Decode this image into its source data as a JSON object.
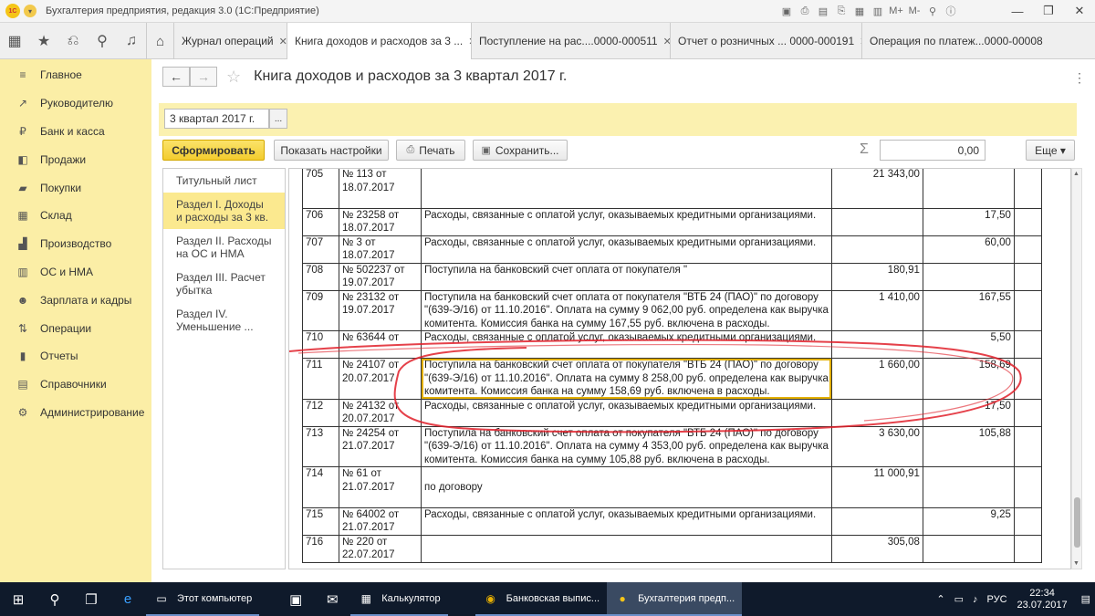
{
  "titlebar": {
    "title": "Бухгалтерия предприятия, редакция 3.0 (1С:Предприятие)",
    "logo": "1С"
  },
  "tabs": [
    {
      "label": "Журнал операций"
    },
    {
      "label": "Книга доходов и расходов за 3 ..."
    },
    {
      "label": "Поступление на рас....0000-000511"
    },
    {
      "label": "Отчет о розничных ... 0000-000191"
    },
    {
      "label": "Операция по платеж...0000-00008"
    }
  ],
  "sidebar": {
    "items": [
      {
        "label": "Главное",
        "icon": "list-icon"
      },
      {
        "label": "Руководителю",
        "icon": "chart-icon"
      },
      {
        "label": "Банк и касса",
        "icon": "ruble-icon"
      },
      {
        "label": "Продажи",
        "icon": "cart-icon"
      },
      {
        "label": "Покупки",
        "icon": "truck-icon"
      },
      {
        "label": "Склад",
        "icon": "warehouse-icon"
      },
      {
        "label": "Производство",
        "icon": "factory-icon"
      },
      {
        "label": "ОС и НМА",
        "icon": "building-icon"
      },
      {
        "label": "Зарплата и кадры",
        "icon": "people-icon"
      },
      {
        "label": "Операции",
        "icon": "dt-kt-icon"
      },
      {
        "label": "Отчеты",
        "icon": "report-icon"
      },
      {
        "label": "Справочники",
        "icon": "book-icon"
      },
      {
        "label": "Администрирование",
        "icon": "gear-icon"
      }
    ]
  },
  "header": {
    "title": "Книга доходов и расходов за 3 квартал 2017 г.",
    "back": "←",
    "forward": "→"
  },
  "params": {
    "period": "3 квартал 2017 г.",
    "period_btn": "..."
  },
  "toolbar": {
    "generate": "Сформировать",
    "show_settings": "Показать настройки",
    "print": "Печать",
    "save": "Сохранить...",
    "sigma": "Σ",
    "sum": "0,00",
    "more": "Еще ▾"
  },
  "toc": [
    {
      "label": "Титульный лист"
    },
    {
      "label": "Раздел I. Доходы и расходы за 3 кв."
    },
    {
      "label": "Раздел II. Расходы на ОС и НМА"
    },
    {
      "label": "Раздел III. Расчет убытка"
    },
    {
      "label": "Раздел IV. Уменьшение ..."
    }
  ],
  "rows": [
    {
      "n": "705",
      "doc": [
        "№ 113 от",
        "18.07.2017"
      ],
      "text": [
        "",
        "",
        ""
      ],
      "income": "21 343,00",
      "expense": ""
    },
    {
      "n": "706",
      "doc": [
        "№ 23258 от",
        "18.07.2017"
      ],
      "text": [
        "Расходы, связанные с оплатой услуг, оказываемых кредитными организациями."
      ],
      "income": "",
      "expense": "17,50"
    },
    {
      "n": "707",
      "doc": [
        "№ 3 от",
        "18.07.2017"
      ],
      "text": [
        "Расходы, связанные с оплатой услуг, оказываемых кредитными организациями."
      ],
      "income": "",
      "expense": "60,00"
    },
    {
      "n": "708",
      "doc": [
        "№ 502237 от",
        "19.07.2017"
      ],
      "text": [
        "Поступила на банковский счет оплата от покупателя \"",
        ""
      ],
      "income": "180,91",
      "expense": ""
    },
    {
      "n": "709",
      "doc": [
        "№ 23132 от",
        "19.07.2017"
      ],
      "text": [
        "Поступила на банковский счет оплата от покупателя \"ВТБ 24 (ПАО)\" по договору",
        "\"(639-Э/16) от 11.10.2016\". Оплата на сумму 9 062,00 руб. определена как выручка",
        "комитента. Комиссия банка на сумму 167,55 руб. включена в расходы."
      ],
      "income": "1 410,00",
      "expense": "167,55"
    },
    {
      "n": "710",
      "doc": [
        "№ 63644 от",
        ""
      ],
      "text": [
        "Расходы, связанные с оплатой услуг, оказываемых кредитными организациями."
      ],
      "income": "",
      "expense": "5,50"
    },
    {
      "n": "711",
      "doc": [
        "№ 24107 от",
        "20.07.2017"
      ],
      "text": [
        "Поступила на банковский счет оплата от покупателя \"ВТБ 24 (ПАО)\" по договору",
        "\"(639-Э/16) от 11.10.2016\". Оплата на сумму 8 258,00 руб. определена как выручка",
        "комитента. Комиссия банка на сумму 158,69 руб. включена в расходы."
      ],
      "income": "1 660,00",
      "expense": "158,69",
      "selected": true
    },
    {
      "n": "712",
      "doc": [
        "№ 24132 от",
        "20.07.2017"
      ],
      "text": [
        "Расходы, связанные с оплатой услуг, оказываемых кредитными организациями."
      ],
      "income": "",
      "expense": "17,50"
    },
    {
      "n": "713",
      "doc": [
        "№ 24254 от",
        "21.07.2017"
      ],
      "text": [
        "Поступила на банковский счет оплата от покупателя \"ВТБ 24 (ПАО)\" по договору",
        "\"(639-Э/16) от 11.10.2016\". Оплата на сумму 4 353,00 руб. определена как выручка",
        "комитента. Комиссия банка на сумму 105,88 руб. включена в расходы."
      ],
      "income": "3 630,00",
      "expense": "105,88"
    },
    {
      "n": "714",
      "doc": [
        "№ 61 от",
        "21.07.2017"
      ],
      "text": [
        "",
        "по договору",
        ""
      ],
      "income": "11 000,91",
      "expense": ""
    },
    {
      "n": "715",
      "doc": [
        "№ 64002 от",
        "21.07.2017"
      ],
      "text": [
        "Расходы, связанные с оплатой услуг, оказываемых кредитными организациями."
      ],
      "income": "",
      "expense": "9,25"
    },
    {
      "n": "716",
      "doc": [
        "№ 220 от",
        "22.07.2017"
      ],
      "text": [
        "",
        ""
      ],
      "income": "305,08",
      "expense": ""
    }
  ],
  "taskbar": {
    "apps": [
      {
        "label": "Этот компьютер",
        "icon": "computer-icon"
      },
      {
        "label": "Калькулятор",
        "icon": "calculator-icon"
      },
      {
        "label": "Банковская выпис...",
        "icon": "chrome-icon"
      },
      {
        "label": "Бухгалтерия предп...",
        "icon": "1c-icon"
      }
    ],
    "lang": "РУС",
    "time": "22:34",
    "date": "23.07.2017"
  },
  "colors": {
    "sidebar": "#fbeea6",
    "primary_button": "#f3cc2e",
    "annotation_ring": "#e0202a",
    "taskbar": "#0f1a2b"
  }
}
